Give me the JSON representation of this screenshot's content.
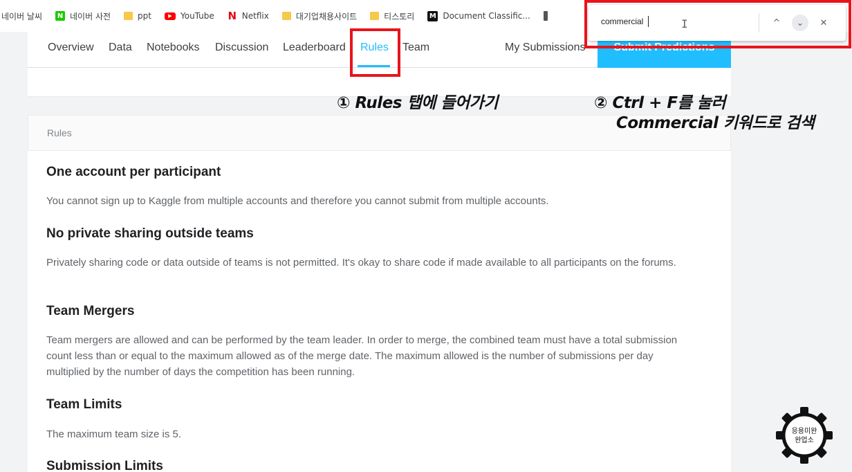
{
  "bookmarks": [
    {
      "label": "네이버 날씨",
      "icon": "none"
    },
    {
      "label": "네이버 사전",
      "icon": "naver-icon"
    },
    {
      "label": "ppt",
      "icon": "folder-icon"
    },
    {
      "label": "YouTube",
      "icon": "youtube-icon"
    },
    {
      "label": "Netflix",
      "icon": "netflix-icon"
    },
    {
      "label": "대기업채용사이트",
      "icon": "folder-icon"
    },
    {
      "label": "티스토리",
      "icon": "folder-icon"
    },
    {
      "label": "Document Classific...",
      "icon": "medium-icon"
    }
  ],
  "tabs": {
    "overview": "Overview",
    "data": "Data",
    "notebooks": "Notebooks",
    "discussion": "Discussion",
    "leaderboard": "Leaderboard",
    "rules": "Rules",
    "team": "Team",
    "my_submissions": "My Submissions",
    "submit": "Submit Predictions",
    "active": "Rules"
  },
  "rules_header": "Rules",
  "sections": [
    {
      "title": "One account per participant",
      "text": "You cannot sign up to Kaggle from multiple accounts and therefore you cannot submit from multiple accounts."
    },
    {
      "title": "No private sharing outside teams",
      "text": "Privately sharing code or data outside of teams is not permitted. It's okay to share code if made available to all participants on the forums."
    },
    {
      "title": "Team Mergers",
      "text": "Team mergers are allowed and can be performed by the team leader. In order to merge, the combined team must have a total submission count less than or equal to the maximum allowed as of the merge date. The maximum allowed is the number of submissions per day multiplied by the number of days the competition has been running."
    },
    {
      "title": "Team Limits",
      "text": "The maximum team size is 5."
    },
    {
      "title": "Submission Limits",
      "text": ""
    }
  ],
  "find_bar": {
    "query": "commercial",
    "prev_label": "^",
    "next_label": "⌄",
    "close_label": "✕"
  },
  "annotations": {
    "step1": "① Rules 탭에 들어가기",
    "step2_line1": "② Ctrl + F를 눌러",
    "step2_line2": "Commercial 키워드로 검색"
  },
  "logo_text": {
    "line1": "응용미완",
    "line2": "완업소"
  },
  "colors": {
    "accent": "#20beff",
    "highlight_box": "#e8141c"
  }
}
